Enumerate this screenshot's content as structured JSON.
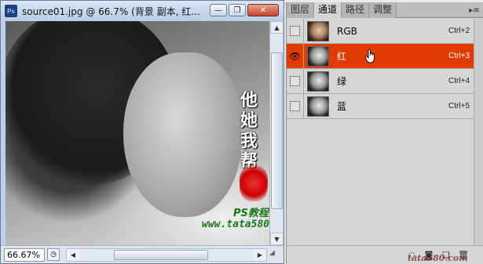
{
  "document": {
    "title": "source01.jpg @ 66.7% (背景 副本, 红...",
    "app_icon": "Ps",
    "window_buttons": {
      "minimize": "—",
      "restore": "❐",
      "close": "✕"
    },
    "zoom": "66.67%",
    "watermark": {
      "calligraphy_lines": [
        "他",
        "她 我",
        "帮",
        "你"
      ],
      "line1": "PS教程网",
      "line2": "www.tata580.com"
    }
  },
  "channels_panel": {
    "tabs": [
      {
        "label": "图层",
        "active": false
      },
      {
        "label": "通道",
        "active": true
      },
      {
        "label": "路径",
        "active": false
      },
      {
        "label": "调整",
        "active": false
      }
    ],
    "menu_icon": "panel-menu-icon",
    "rows": [
      {
        "name": "RGB",
        "shortcut": "Ctrl+2",
        "visible": false,
        "selected": false
      },
      {
        "name": "红",
        "shortcut": "Ctrl+3",
        "visible": true,
        "selected": true
      },
      {
        "name": "绿",
        "shortcut": "Ctrl+4",
        "visible": false,
        "selected": false
      },
      {
        "name": "蓝",
        "shortcut": "Ctrl+5",
        "visible": false,
        "selected": false
      }
    ],
    "footer_watermark": "tata580.com"
  },
  "colors": {
    "selected_row": "#e23b00",
    "titlebar": "#bcd0e8",
    "panel_bg": "#d6d6d6"
  }
}
